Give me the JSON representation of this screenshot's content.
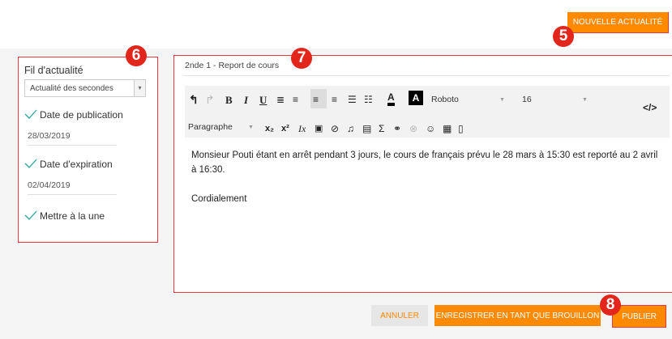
{
  "header": {
    "new_news_button": "NOUVELLE ACTUALITÉ"
  },
  "markers": {
    "m5": "5",
    "m6": "6",
    "m7": "7",
    "m8": "8"
  },
  "sidebar": {
    "title": "Fil d'actualité",
    "feed_select": "Actualité des secondes",
    "publication_label": "Date de publication",
    "publication_date": "28/03/2019",
    "expiration_label": "Date d'expiration",
    "expiration_date": "02/04/2019",
    "headline_label": "Mettre à la une"
  },
  "editor": {
    "title": "2nde 1 - Report de cours",
    "font_name": "Roboto",
    "font_size": "16",
    "format": "Paragraphe",
    "body_line1": "Monsieur Pouti étant en arrêt pendant 3 jours, le cours de français prévu le 28 mars à 15:30 est reporté au 2 avril à 16:30.",
    "body_line2": "Cordialement"
  },
  "footer": {
    "cancel": "ANNULER",
    "save_draft": "ENREGISTRER EN TANT QUE BROUILLON",
    "publish": "PUBLIER"
  },
  "icons": [
    "undo-icon",
    "redo-icon",
    "bold-icon",
    "italic-icon",
    "underline-icon",
    "align-justify-icon",
    "align-center-icon",
    "align-left-icon",
    "align-right-icon",
    "bullet-list-icon",
    "numbered-list-icon",
    "text-color-icon",
    "background-color-icon",
    "source-code-icon",
    "subscript-icon",
    "superscript-icon",
    "clear-format-icon",
    "image-icon",
    "attachment-icon",
    "audio-icon",
    "video-icon",
    "formula-icon",
    "link-icon",
    "unlink-icon",
    "emoji-icon",
    "table-icon",
    "document-icon",
    "check-icon",
    "chevron-down-icon"
  ],
  "colors": {
    "accent": "#ff8a00",
    "marker": "#e3261b",
    "frame": "#e8383d",
    "check": "#2aa79b"
  }
}
